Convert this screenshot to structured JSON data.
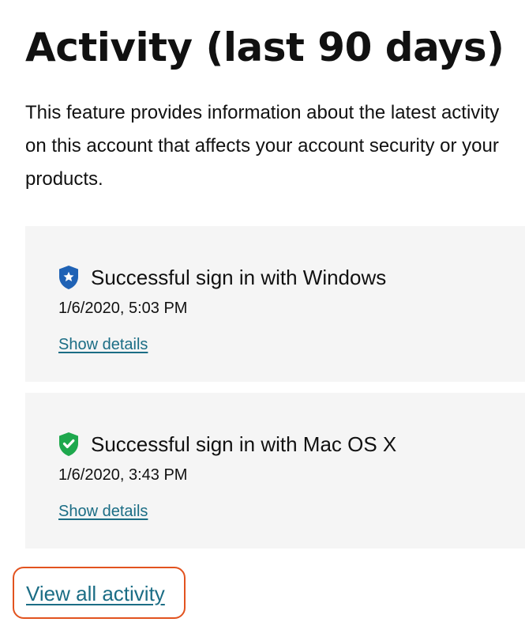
{
  "page": {
    "title": "Activity (last 90 days)",
    "description": "This feature provides information about the latest activity on this account that affects your account security or your products."
  },
  "activities": [
    {
      "icon": "shield-star-icon",
      "icon_color": "#1f62b5",
      "title": "Successful sign in with Windows",
      "datetime": "1/6/2020, 5:03 PM",
      "link_label": "Show details"
    },
    {
      "icon": "shield-check-icon",
      "icon_color": "#1ea84d",
      "title": "Successful sign in with Mac OS X",
      "datetime": "1/6/2020, 3:43 PM",
      "link_label": "Show details"
    }
  ],
  "footer": {
    "view_all_label": "View all activity"
  },
  "colors": {
    "link": "#1b6d85",
    "card_background": "#f5f5f5",
    "highlight": "#e2531f"
  }
}
